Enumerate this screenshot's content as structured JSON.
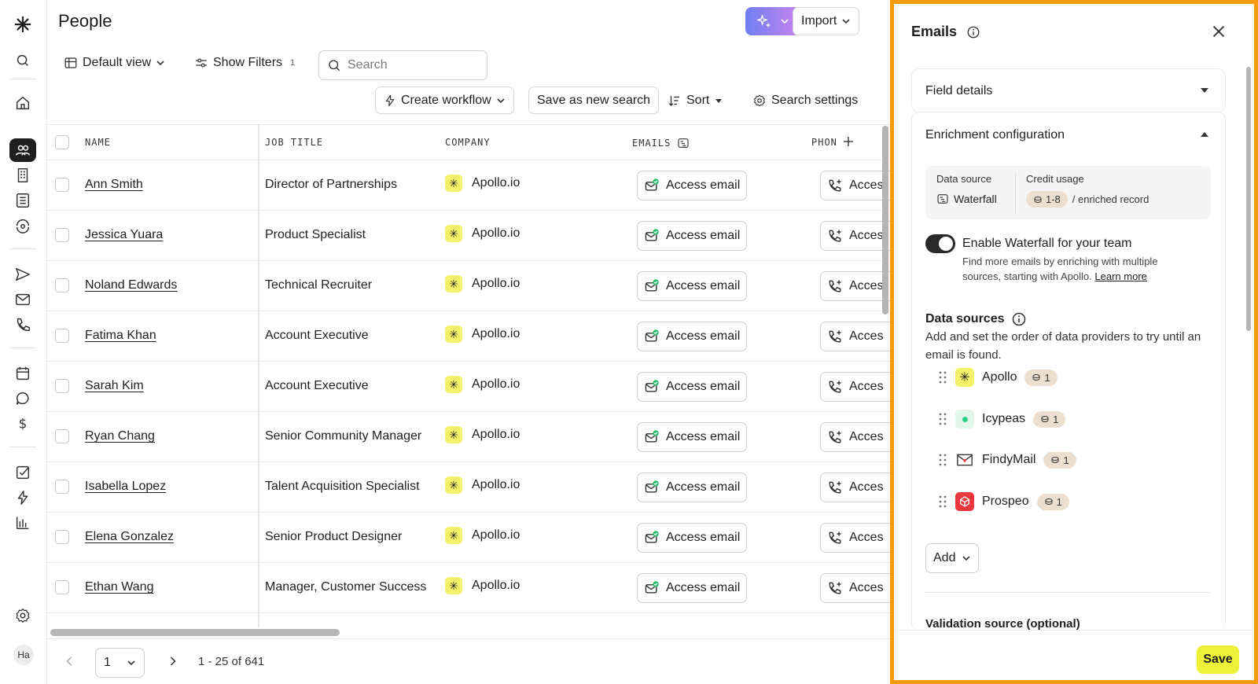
{
  "page": {
    "title": "People"
  },
  "toolbar": {
    "import_label": "Import",
    "default_view_label": "Default view",
    "show_filters_label": "Show Filters",
    "filters_count": "1",
    "search_placeholder": "Search",
    "create_workflow_label": "Create workflow",
    "save_search_label": "Save as new search",
    "sort_label": "Sort",
    "search_settings_label": "Search settings"
  },
  "table": {
    "columns": [
      "NAME",
      "JOB TITLE",
      "COMPANY",
      "EMAILS",
      "PHON"
    ],
    "access_email_label": "Access email",
    "access_phone_label": "Acces",
    "rows": [
      {
        "name": "Ann Smith",
        "title": "Director of Partnerships",
        "company": "Apollo.io"
      },
      {
        "name": "Jessica Yuara",
        "title": "Product Specialist",
        "company": "Apollo.io"
      },
      {
        "name": "Noland Edwards",
        "title": "Technical Recruiter",
        "company": "Apollo.io"
      },
      {
        "name": "Fatima Khan",
        "title": "Account Executive",
        "company": "Apollo.io"
      },
      {
        "name": "Sarah Kim",
        "title": "Account Executive",
        "company": "Apollo.io"
      },
      {
        "name": "Ryan Chang",
        "title": "Senior Community Manager",
        "company": "Apollo.io"
      },
      {
        "name": "Isabella Lopez",
        "title": "Talent Acquisition Specialist",
        "company": "Apollo.io"
      },
      {
        "name": "Elena Gonzalez",
        "title": "Senior Product Designer",
        "company": "Apollo.io"
      },
      {
        "name": "Ethan Wang",
        "title": "Manager, Customer Success",
        "company": "Apollo.io"
      }
    ]
  },
  "pagination": {
    "page": "1",
    "range": "1 - 25 of 641"
  },
  "user": {
    "initials": "Ha"
  },
  "panel": {
    "title": "Emails",
    "field_details": "Field details",
    "enrichment_config": "Enrichment configuration",
    "data_source_label": "Data source",
    "data_source_value": "Waterfall",
    "credit_usage_label": "Credit usage",
    "credit_usage_value": "1-8",
    "credit_usage_suffix": "/ enriched record",
    "toggle_title": "Enable Waterfall for your team",
    "toggle_desc": "Find more emails by enriching with multiple sources, starting with Apollo.",
    "learn_more": "Learn more",
    "toggle_on": true,
    "data_sources_heading": "Data sources",
    "data_sources_desc": "Add and set the order of data providers to try until an email is found.",
    "providers": [
      {
        "name": "Apollo",
        "credits": "1",
        "color": "#f4f26b"
      },
      {
        "name": "Icypeas",
        "credits": "1",
        "color": "#e3f6ec"
      },
      {
        "name": "FindyMail",
        "credits": "1",
        "color": "#ffffff"
      },
      {
        "name": "Prospeo",
        "credits": "1",
        "color": "#e8383d"
      }
    ],
    "add_label": "Add",
    "validation_title": "Validation source (optional)",
    "save_label": "Save"
  },
  "colors": {
    "panel_border": "#f79a0b",
    "save_button": "#ecf23a",
    "apollo_brand": "#f4f26b"
  }
}
